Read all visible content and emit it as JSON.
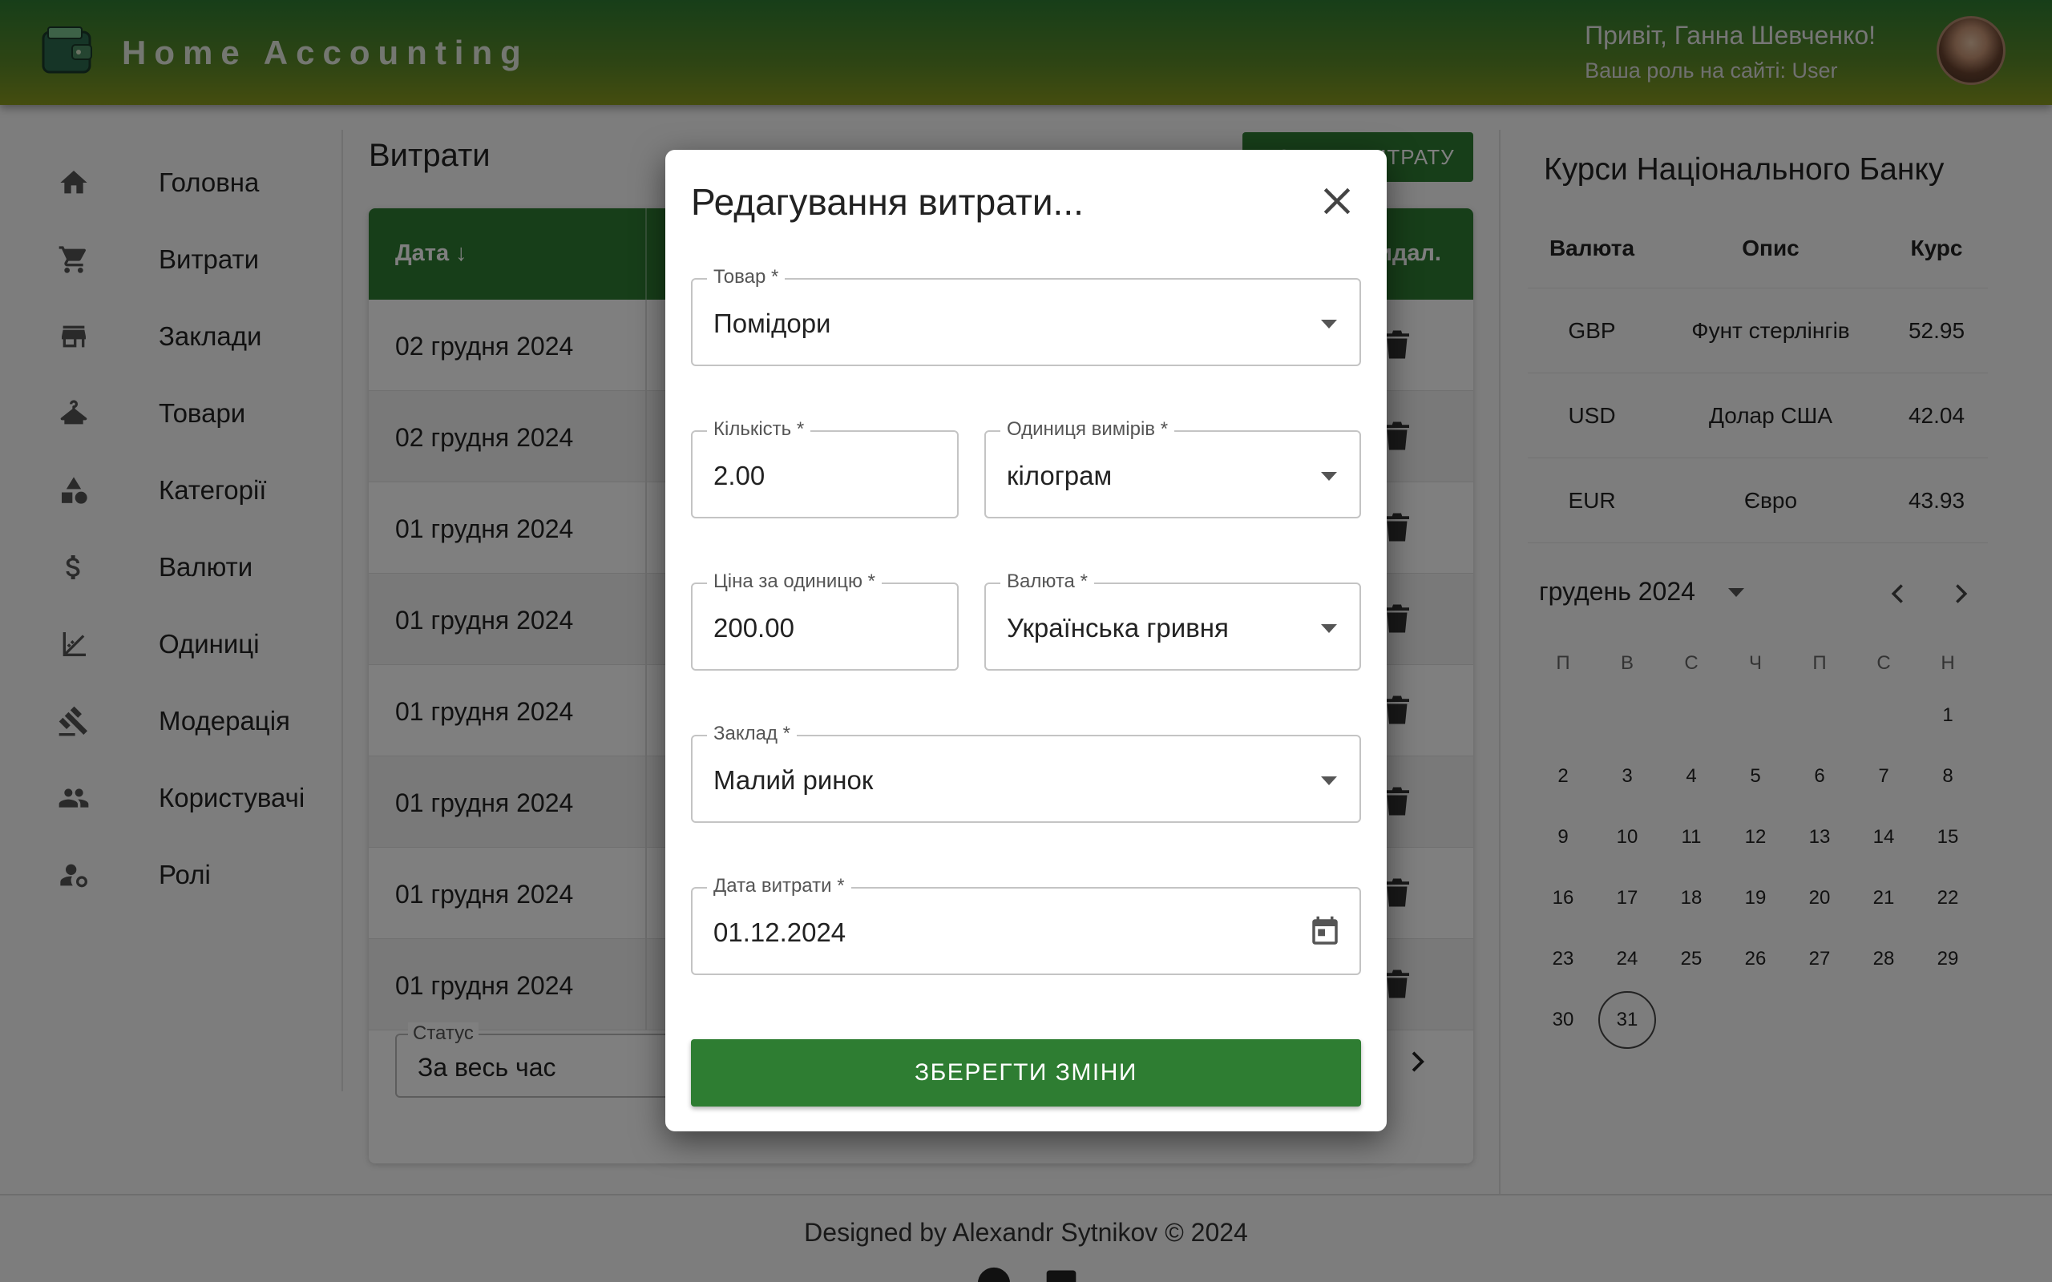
{
  "header": {
    "app_title": "Home Accounting",
    "greeting": "Привіт, Ганна Шевченко!",
    "role": "Ваша роль на сайті: User"
  },
  "sidebar": {
    "items": [
      {
        "label": "Головна",
        "icon": "home-icon"
      },
      {
        "label": "Витрати",
        "icon": "cart-icon"
      },
      {
        "label": "Заклади",
        "icon": "store-icon"
      },
      {
        "label": "Товари",
        "icon": "hanger-icon"
      },
      {
        "label": "Категорії",
        "icon": "category-icon"
      },
      {
        "label": "Валюти",
        "icon": "dollar-icon"
      },
      {
        "label": "Одиниці",
        "icon": "measure-icon"
      },
      {
        "label": "Модерація",
        "icon": "gavel-icon"
      },
      {
        "label": "Користувачі",
        "icon": "people-icon"
      },
      {
        "label": "Ролі",
        "icon": "role-settings-icon"
      }
    ]
  },
  "main": {
    "title": "Витрати",
    "add_button": "ДОДАТИ ВИТРАТУ",
    "columns": {
      "date": "Дата ↓",
      "delete": "Видал."
    },
    "rows": [
      "02 грудня 2024",
      "02 грудня 2024",
      "01 грудня 2024",
      "01 грудня 2024",
      "01 грудня 2024",
      "01 грудня 2024",
      "01 грудня 2024",
      "01 грудня 2024"
    ],
    "status_label": "Статус",
    "status_value": "За весь час"
  },
  "rates": {
    "title": "Курси Національного Банку",
    "headers": {
      "currency": "Валюта",
      "description": "Опис",
      "rate": "Курс"
    },
    "rows": [
      {
        "currency": "GBP",
        "description": "Фунт стерлінгів",
        "rate": "52.95"
      },
      {
        "currency": "USD",
        "description": "Долар США",
        "rate": "42.04"
      },
      {
        "currency": "EUR",
        "description": "Євро",
        "rate": "43.93"
      }
    ]
  },
  "calendar": {
    "month": "грудень 2024",
    "weekdays": [
      "П",
      "В",
      "С",
      "Ч",
      "П",
      "С",
      "Н"
    ],
    "leading_blanks": 6,
    "days": 31,
    "today": 31
  },
  "footer": {
    "text": "Designed by Alexandr Sytnikov © 2024"
  },
  "modal": {
    "title": "Редагування витрати...",
    "product": {
      "label": "Товар *",
      "value": "Помідори"
    },
    "quantity": {
      "label": "Кількість *",
      "value": "2.00"
    },
    "unit": {
      "label": "Одиниця вимірів *",
      "value": "кілограм"
    },
    "price": {
      "label": "Ціна за одиницю *",
      "value": "200.00"
    },
    "currency": {
      "label": "Валюта *",
      "value": "Українська гривня"
    },
    "place": {
      "label": "Заклад *",
      "value": "Малий ринок"
    },
    "date": {
      "label": "Дата витрати *",
      "value": "01.12.2024"
    },
    "save_button": "ЗБЕРЕГТИ ЗМІНИ"
  },
  "colors": {
    "primary": "#2e7d32",
    "header_gradient_end": "#8a9a1f"
  }
}
